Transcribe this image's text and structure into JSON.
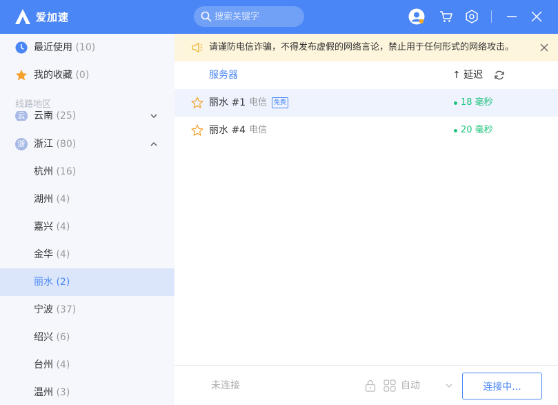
{
  "app": {
    "title": "爱加速",
    "brand_color": "#4a86f5"
  },
  "search": {
    "placeholder": "搜索关键字"
  },
  "header_icons": [
    "user-avatar-icon",
    "cart-icon",
    "gear-icon",
    "minimize-icon",
    "close-icon"
  ],
  "sidebar": {
    "recent": {
      "label": "最近使用",
      "count": "(10)"
    },
    "favorites": {
      "label": "我的收藏",
      "count": "(0)"
    },
    "section_label": "线路地区",
    "partial_region": {
      "badge": "云",
      "label": "云南",
      "count": "(25)"
    },
    "province": {
      "badge": "浙",
      "label": "浙江",
      "count": "(80)",
      "expanded": true
    },
    "cities": [
      {
        "label": "杭州",
        "count": "(16)"
      },
      {
        "label": "湖州",
        "count": "(4)"
      },
      {
        "label": "嘉兴",
        "count": "(4)"
      },
      {
        "label": "金华",
        "count": "(4)"
      },
      {
        "label": "丽水",
        "count": "(2)",
        "selected": true
      },
      {
        "label": "宁波",
        "count": "(37)"
      },
      {
        "label": "绍兴",
        "count": "(6)"
      },
      {
        "label": "台州",
        "count": "(4)"
      },
      {
        "label": "温州",
        "count": "(3)"
      }
    ]
  },
  "notice": {
    "text": "请谨防电信诈骗，不得发布虚假的网络言论，禁止用于任何形式的网络攻击。"
  },
  "columns": {
    "server": "服务器",
    "latency": "↑ 延迟"
  },
  "servers": [
    {
      "name": "丽水 #1",
      "isp": "电信",
      "tag": "免费",
      "latency": "18 毫秒",
      "highlight": true
    },
    {
      "name": "丽水 #4",
      "isp": "电信",
      "tag": "",
      "latency": "20 毫秒",
      "highlight": false
    }
  ],
  "footer": {
    "status": "未连接",
    "mode": "自动",
    "connect_button": "连接中..."
  },
  "colors": {
    "latency_good": "#1dc27b",
    "notice_bg": "#fdf5dc",
    "selected_bg": "#dbe6fb"
  }
}
